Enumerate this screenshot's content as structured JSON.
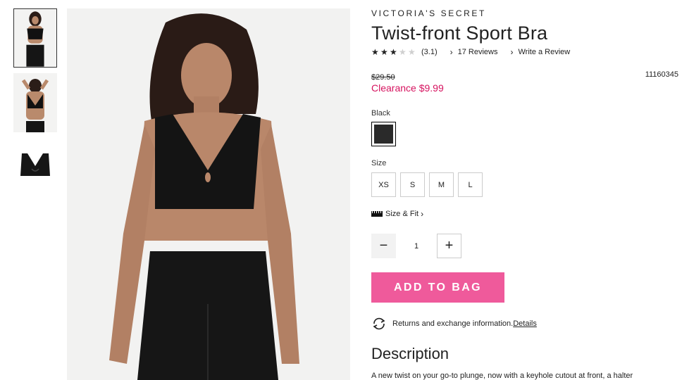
{
  "product": {
    "brand": "VICTORIA'S SECRET",
    "title": "Twist-front Sport Bra",
    "rating": 3.1,
    "rating_text": "(3.1)",
    "reviews_link": "17 Reviews",
    "write_review_link": "Write a Review",
    "original_price": "$29.50",
    "sale_price": "Clearance $9.99",
    "sku": "11160345"
  },
  "color": {
    "label": "Black",
    "swatch_color": "#2a2a2a"
  },
  "size": {
    "label": "Size",
    "options": [
      "XS",
      "S",
      "M",
      "L"
    ],
    "size_fit_label": "Size & Fit"
  },
  "quantity": {
    "value": "1",
    "minus_symbol": "−",
    "plus_symbol": "+"
  },
  "cart": {
    "add_label": "ADD TO BAG",
    "accent": "#ef5a9b"
  },
  "returns": {
    "text": "Returns and exchange information.",
    "link": "Details"
  },
  "description": {
    "heading": "Description",
    "text": "A new twist on your go-to plunge, now with a keyhole cutout at front, a halter"
  },
  "icons": {
    "star": "star-icon",
    "chevron": "chevron-right-icon",
    "ruler": "ruler-icon",
    "returns": "returns-icon"
  }
}
